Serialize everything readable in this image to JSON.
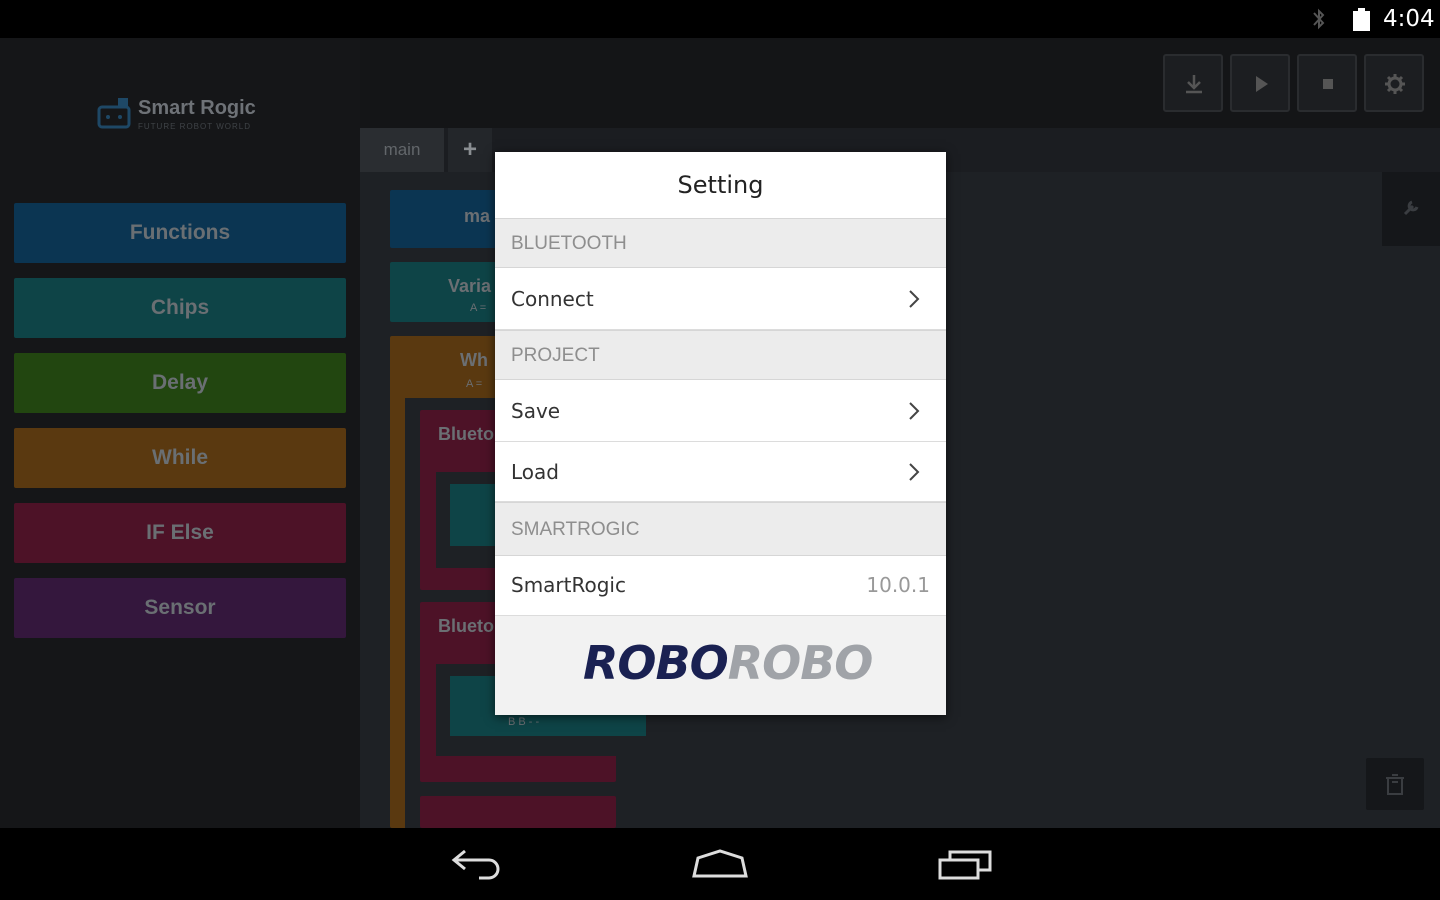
{
  "status_bar": {
    "time": "4:04",
    "icons": [
      "bluetooth-icon",
      "battery-icon"
    ]
  },
  "sidebar": {
    "logo_text": "Smart Rogic",
    "logo_subtext": "FUTURE ROBOT WORLD",
    "categories": [
      {
        "label": "Functions",
        "color": "#0b3552"
      },
      {
        "label": "Chips",
        "color": "#0e4447"
      },
      {
        "label": "Delay",
        "color": "#224610"
      },
      {
        "label": "While",
        "color": "#5a3910"
      },
      {
        "label": "IF Else",
        "color": "#4d1227"
      },
      {
        "label": "Sensor",
        "color": "#34173d"
      }
    ]
  },
  "toolbar": {
    "buttons": [
      "download-icon",
      "play-icon",
      "stop-icon",
      "gear-icon"
    ]
  },
  "tabs": {
    "main_label": "main",
    "add_label": "+"
  },
  "canvas_blocks": {
    "main": "ma",
    "variable": "Varia",
    "variable_sub": "A =",
    "while": "Wh",
    "while_sub": "A =",
    "bluetooth1": "Blueto",
    "bluetooth2": "Blueto",
    "sub_values": "B  B  -  -"
  },
  "dialog": {
    "title": "Setting",
    "sections": [
      {
        "header": "BLUETOOTH",
        "rows": [
          {
            "label": "Connect"
          }
        ]
      },
      {
        "header": "PROJECT",
        "rows": [
          {
            "label": "Save"
          },
          {
            "label": "Load"
          }
        ]
      },
      {
        "header": "SMARTROGIC",
        "rows": [
          {
            "label": "SmartRogic",
            "value": "10.0.1"
          }
        ]
      }
    ],
    "brand_part1": "ROBO",
    "brand_part2": "ROBO"
  },
  "nav_bar": {
    "icons": [
      "back-icon",
      "home-icon",
      "recent-apps-icon"
    ]
  }
}
